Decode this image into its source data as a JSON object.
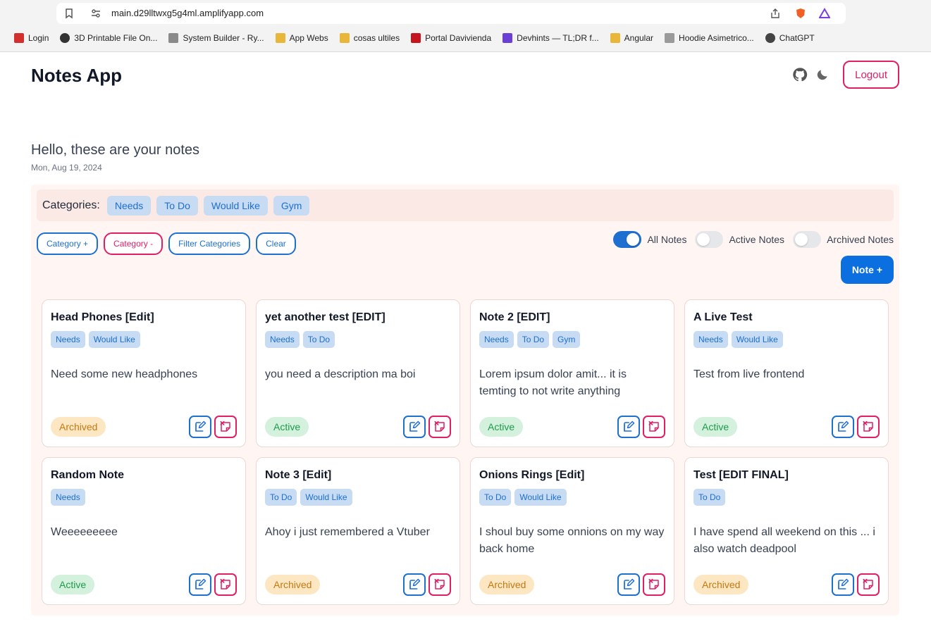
{
  "browser": {
    "url": "main.d29lltwxg5g4ml.amplifyapp.com",
    "bookmarks": [
      {
        "label": "Login",
        "icon": "login-favicon",
        "color": "#d32f2f"
      },
      {
        "label": "3D Printable File On...",
        "icon": "globe-favicon",
        "color": "#333333"
      },
      {
        "label": "System Builder - Ry...",
        "icon": "cube-favicon",
        "color": "#555555"
      },
      {
        "label": "App Webs",
        "icon": "folder-icon",
        "color": "#e8b73a"
      },
      {
        "label": "cosas ultiles",
        "icon": "folder-icon",
        "color": "#e8b73a"
      },
      {
        "label": "Portal Davivienda",
        "icon": "davivienda-favicon",
        "color": "#c4161c"
      },
      {
        "label": "Devhints — TL;DR f...",
        "icon": "devhints-favicon",
        "color": "#6b3fd6"
      },
      {
        "label": "Angular",
        "icon": "folder-icon",
        "color": "#e8b73a"
      },
      {
        "label": "Hoodie Asimetrico...",
        "icon": "hoodie-favicon",
        "color": "#777777"
      },
      {
        "label": "ChatGPT",
        "icon": "chatgpt-favicon",
        "color": "#444444"
      }
    ]
  },
  "header": {
    "brand": "Notes App",
    "logout_label": "Logout"
  },
  "greeting": {
    "title": "Hello, these are your notes",
    "date": "Mon, Aug 19, 2024"
  },
  "categories": {
    "label": "Categories:",
    "items": [
      "Needs",
      "To Do",
      "Would Like",
      "Gym"
    ]
  },
  "actions": {
    "category_add": "Category +",
    "category_remove": "Category -",
    "filter": "Filter Categories",
    "clear": "Clear",
    "note_add": "Note +"
  },
  "filters": {
    "all_notes": "All Notes",
    "active_notes": "Active Notes",
    "archived_notes": "Archived Notes",
    "all_on": true,
    "active_on": false,
    "archived_on": false
  },
  "colors": {
    "accent_blue": "#1d6fd0",
    "accent_red": "#e11d63",
    "panel_bg": "#fff5f2"
  },
  "notes": [
    {
      "title": "Head Phones [Edit]",
      "tags": [
        "Needs",
        "Would Like"
      ],
      "desc": "Need some new headphones",
      "status": "Archived"
    },
    {
      "title": "yet another test [EDIT]",
      "tags": [
        "Needs",
        "To Do"
      ],
      "desc": "you need a description ma boi",
      "status": "Active"
    },
    {
      "title": "Note 2 [EDIT]",
      "tags": [
        "Needs",
        "To Do",
        "Gym"
      ],
      "desc": "Lorem ipsum dolor amit... it is temting to not write anything",
      "status": "Active"
    },
    {
      "title": "A Live Test",
      "tags": [
        "Needs",
        "Would Like"
      ],
      "desc": "Test from live frontend",
      "status": "Active"
    },
    {
      "title": "Random Note",
      "tags": [
        "Needs"
      ],
      "desc": "Weeeeeeeee",
      "status": "Active"
    },
    {
      "title": "Note 3 [Edit]",
      "tags": [
        "To Do",
        "Would Like"
      ],
      "desc": "Ahoy i just remembered a Vtuber",
      "status": "Archived"
    },
    {
      "title": "Onions Rings [Edit]",
      "tags": [
        "To Do",
        "Would Like"
      ],
      "desc": "I shoul buy some onnions on my way back home",
      "status": "Archived"
    },
    {
      "title": "Test [EDIT FINAL]",
      "tags": [
        "To Do"
      ],
      "desc": "I have spend all weekend on this ... i also watch deadpool",
      "status": "Archived"
    }
  ]
}
